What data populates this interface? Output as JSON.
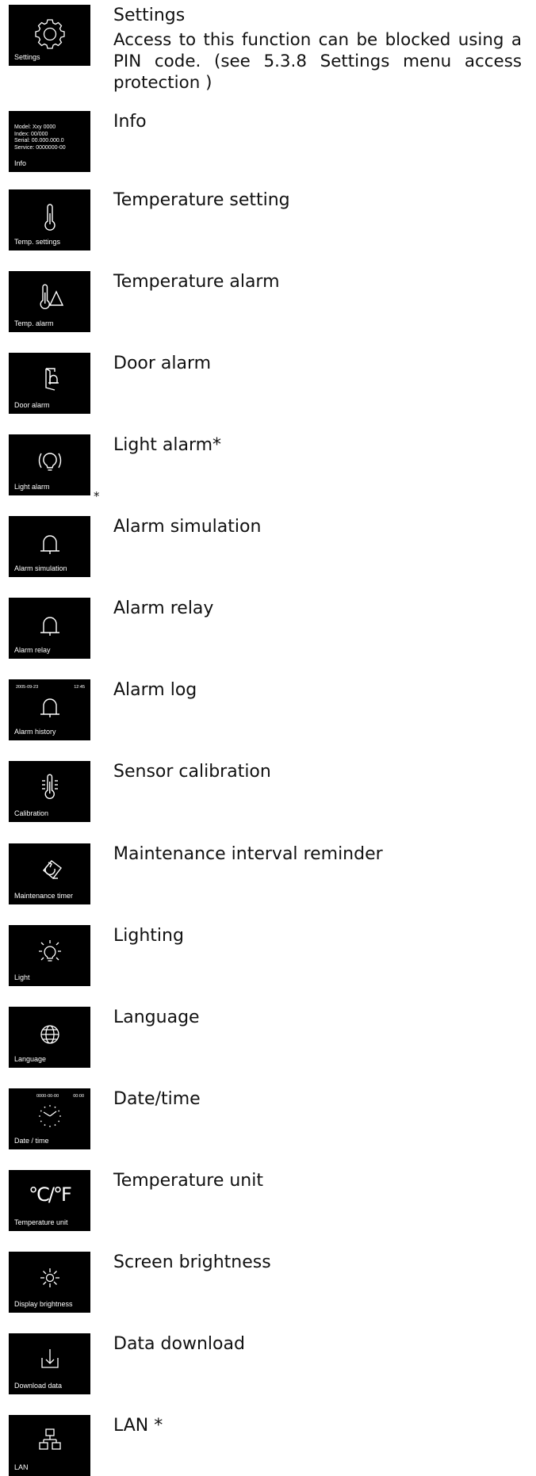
{
  "items": [
    {
      "tile_label": "Settings",
      "title": "Settings",
      "description": "Access to this function can be blocked using a PIN code. (see 5.3.8 Settings menu access protection )",
      "icon": "gear-icon"
    },
    {
      "tile_label": "Info",
      "title": "Info",
      "info_lines": [
        "Model: Xxy 0000",
        "Index: 00/000",
        "Serial: 00.000.000.0",
        "Service: 0000000-00"
      ]
    },
    {
      "tile_label": "Temp. settings",
      "title": "Temperature setting",
      "icon": "thermometer-icon"
    },
    {
      "tile_label": "Temp. alarm",
      "title": "Temperature alarm",
      "icon": "thermometer-warning-icon"
    },
    {
      "tile_label": "Door alarm",
      "title": "Door alarm",
      "icon": "door-bell-icon"
    },
    {
      "tile_label": "Light alarm",
      "title": "Light alarm*",
      "asterisk": "*",
      "icon": "light-bulb-alarm-icon"
    },
    {
      "tile_label": "Alarm simulation",
      "title": "Alarm simulation",
      "icon": "bell-icon"
    },
    {
      "tile_label": "Alarm relay",
      "title": "Alarm relay",
      "icon": "bell-icon"
    },
    {
      "tile_label": "Alarm history",
      "title": "Alarm log",
      "top_date": "2005-09-23",
      "top_time": "12:45",
      "icon": "bell-icon"
    },
    {
      "tile_label": "Calibration",
      "title": "Sensor calibration",
      "icon": "thermometer-calibration-icon"
    },
    {
      "tile_label": "Maintenance  timer",
      "title": "Maintenance interval reminder",
      "icon": "maintenance-timer-icon"
    },
    {
      "tile_label": "Light",
      "title": "Lighting",
      "icon": "light-bulb-icon"
    },
    {
      "tile_label": "Language",
      "title": "Language",
      "icon": "globe-icon"
    },
    {
      "tile_label": "Date / time",
      "title": "Date/time",
      "top_date": "0000-00-00",
      "top_time": "00:00",
      "icon": "clock-icon"
    },
    {
      "tile_label": "Temperature unit",
      "title": "Temperature unit",
      "unit_glyph": "°C/°F"
    },
    {
      "tile_label": "Display brightness",
      "title": "Screen brightness",
      "icon": "sun-icon"
    },
    {
      "tile_label": "Download data",
      "title": "Data download",
      "icon": "download-icon"
    },
    {
      "tile_label": "LAN",
      "title": "LAN *",
      "icon": "network-icon"
    }
  ]
}
